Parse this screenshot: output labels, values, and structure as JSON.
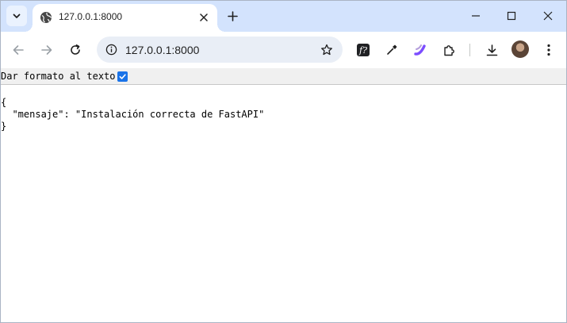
{
  "tab": {
    "title": "127.0.0.1:8000"
  },
  "toolbar": {
    "url": "127.0.0.1:8000"
  },
  "pretty_print": {
    "label": "Dar formato al texto",
    "checked": true
  },
  "json_lines": {
    "open": "{",
    "line1": "  \"mensaje\": \"Instalación correcta de FastAPI\"",
    "close": "}"
  },
  "icons": {
    "tab_search": "chevron-down-icon",
    "favicon": "globe-icon",
    "tab_close": "close-icon",
    "new_tab": "plus-icon",
    "minimize": "minimize-icon",
    "maximize": "maximize-icon",
    "close_window": "close-icon",
    "back": "arrow-left-icon",
    "forward": "arrow-right-icon",
    "reload": "reload-icon",
    "site_info": "info-icon",
    "bookmark": "star-icon",
    "ext1": "font-icon",
    "ext2": "eyedropper-icon",
    "ext3": "slash-icon",
    "extensions": "puzzle-icon",
    "downloads": "download-icon",
    "menu": "kebab-menu-icon"
  },
  "colors": {
    "tabstrip": "#d3e3fd",
    "omnibox": "#e9eef6",
    "checkbox": "#1a73e8",
    "ext3_accent": "#7c4dff"
  }
}
